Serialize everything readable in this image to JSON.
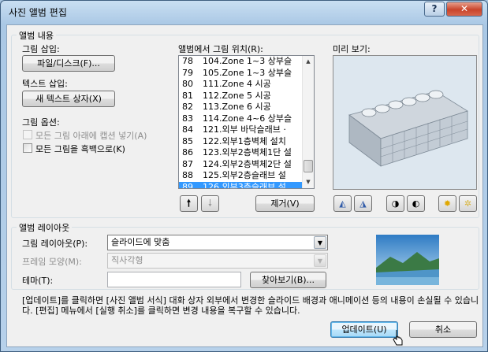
{
  "window": {
    "title": "사진 앨범 편집",
    "help_label": "?",
    "close_label": "✕"
  },
  "album_content": {
    "group_label": "앨범 내용",
    "insert_picture_label": "그림 삽입:",
    "file_disk_button": "파일/디스크(F)...",
    "insert_text_label": "텍스트 삽입:",
    "new_textbox_button": "새 텍스트 상자(X)",
    "picture_options_label": "그림 옵션:",
    "caption_option": "모든 그림 아래에 캡션 넣기(A)",
    "bw_option": "모든 그림을 흑백으로(K)"
  },
  "picture_list": {
    "label": "앨범에서 그림 위치(R):",
    "items": [
      {
        "num": "78",
        "text": "104.Zone 1~3 상부슬"
      },
      {
        "num": "79",
        "text": "105.Zone 1~3 상부슬"
      },
      {
        "num": "80",
        "text": "111.Zone 4 시공"
      },
      {
        "num": "81",
        "text": "112.Zone 5 시공"
      },
      {
        "num": "82",
        "text": "113.Zone 6 시공"
      },
      {
        "num": "83",
        "text": "114.Zone 4~6 상부슬"
      },
      {
        "num": "84",
        "text": "121.외부 바닥슬래브 ·"
      },
      {
        "num": "85",
        "text": "122.외부1층벽체 설치"
      },
      {
        "num": "86",
        "text": "123.외부2층벽체1단 설"
      },
      {
        "num": "87",
        "text": "124.외부2층벽체2단 설"
      },
      {
        "num": "88",
        "text": "125.외부2층슬래브 설"
      },
      {
        "num": "89",
        "text": "126.외부3층슬래브 설"
      }
    ],
    "selected_num": "89",
    "move_up_icon": "arrow-up-icon",
    "move_down_icon": "arrow-down-icon",
    "remove_button": "제거(V)"
  },
  "preview": {
    "label": "미리 보기:",
    "icons": [
      "rotate-left-icon",
      "rotate-right-icon",
      "contrast-up-icon",
      "contrast-down-icon",
      "brightness-up-icon",
      "brightness-down-icon"
    ]
  },
  "album_layout": {
    "group_label": "앨범 레이아웃",
    "picture_layout_label": "그림 레이아웃(P):",
    "picture_layout_value": "슬라이드에 맞춤",
    "frame_shape_label": "프레임 모양(M):",
    "frame_shape_value": "직사각형",
    "theme_label": "테마(T):",
    "theme_value": "",
    "browse_button": "찾아보기(B)..."
  },
  "info_text": "[업데이트]를 클릭하면 [사진 앨범 서식] 대화 상자 외부에서 변경한 슬라이드 배경과 애니메이션 등의 내용이 손실될 수 있습니다. [편집] 메뉴에서 [실행 취소]를 클릭하면 변경 내용을 복구할 수 있습니다.",
  "footer": {
    "update_button": "업데이트(U)",
    "cancel_button": "취소"
  }
}
